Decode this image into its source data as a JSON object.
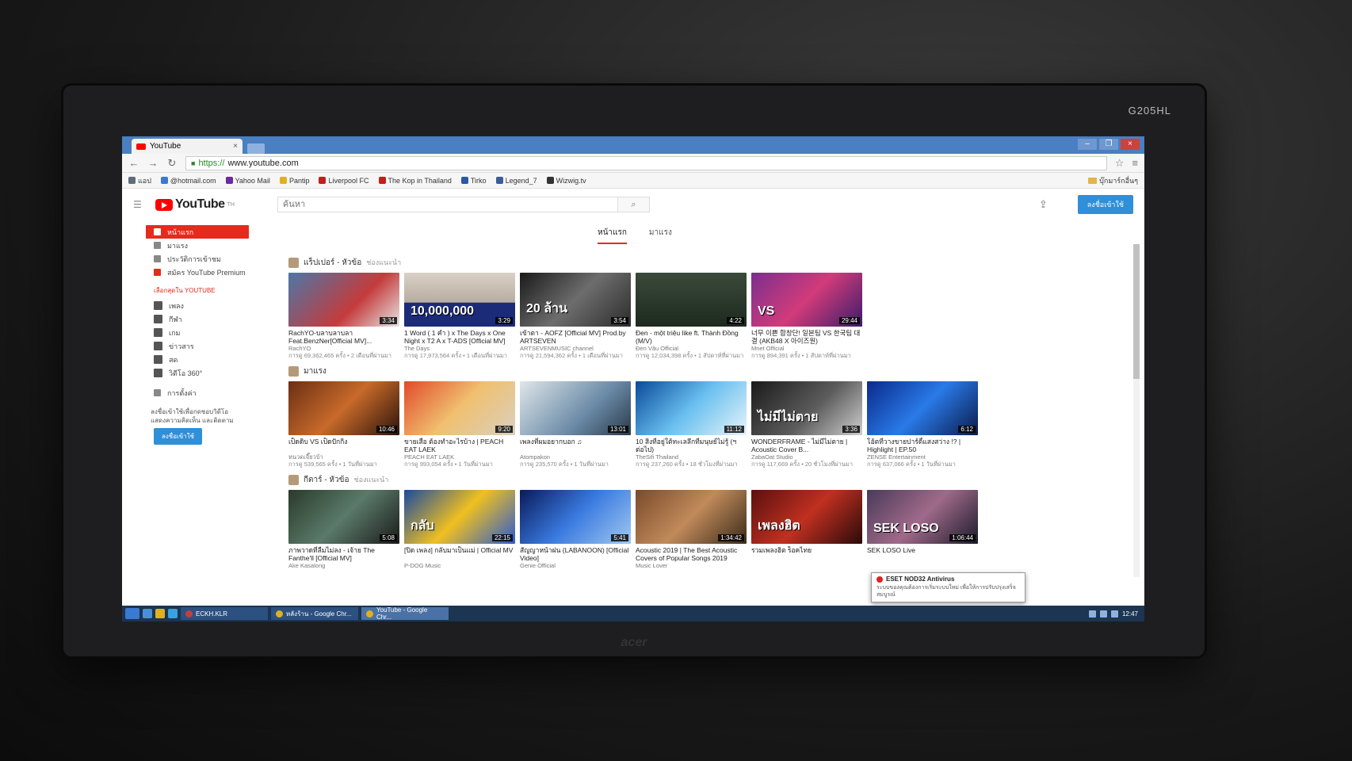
{
  "monitor": {
    "model": "G205HL",
    "brand": "acer"
  },
  "browser": {
    "tab_title": "YouTube",
    "tab_close": "×",
    "window_buttons": [
      "–",
      "❐",
      "×"
    ],
    "url_https": "https://",
    "url_rest": "www.youtube.com",
    "bookmarks": [
      {
        "label": "แอป",
        "color": "#5f6b7a"
      },
      {
        "label": "@hotmail.com",
        "color": "#3a7ad0"
      },
      {
        "label": "Yahoo Mail",
        "color": "#6a2aa0"
      },
      {
        "label": "Pantip",
        "color": "#e0b020"
      },
      {
        "label": "Liverpool FC",
        "color": "#c0201a"
      },
      {
        "label": "The Kop in Thailand",
        "color": "#c0201a"
      },
      {
        "label": "Tirko",
        "color": "#2a5aa0"
      },
      {
        "label": "Legend_7",
        "color": "#3a5a9a"
      },
      {
        "label": "Wizwig.tv",
        "color": "#333333"
      }
    ],
    "bookmarks_other": "บุ๊กมาร์กอื่นๆ"
  },
  "youtube": {
    "logo_text": "YouTube",
    "logo_sup": "TH",
    "search_placeholder": "ค้นหา",
    "signin_label": "ลงชื่อเข้าใช้",
    "tabs": [
      {
        "label": "หน้าแรก",
        "active": true
      },
      {
        "label": "มาแรง",
        "active": false
      }
    ],
    "sidebar": {
      "primary": [
        {
          "label": "หน้าแรก",
          "active": true
        },
        {
          "label": "มาแรง",
          "active": false
        },
        {
          "label": "ประวัติการเข้าชม",
          "active": false
        },
        {
          "label": "สมัคร YouTube Premium",
          "active": false
        }
      ],
      "section_title": "เลือกสุดใน YOUTUBE",
      "best": [
        "เพลง",
        "กีฬา",
        "เกม",
        "ข่าวสาร",
        "สด",
        "วิดีโอ 360°"
      ],
      "settings_label": "การตั้งค่า",
      "signin_note": "ลงชื่อเข้าใช้เพื่อกดชอบวิดีโอ แสดงความคิดเห็น และติดตาม",
      "signin_label": "ลงชื่อเข้าใช้"
    },
    "shelves": [
      {
        "title": "แร็ปเปอร์ - หัวข้อ",
        "subtitle": "ช่องแนะนำ",
        "videos": [
          {
            "title": "RachYO-บลาบลาบลา Feat.BenzNer[Official MV]...",
            "channel": "RachYO",
            "meta": "การดู 69,362,465 ครั้ง • 2 เดือนที่ผ่านมา",
            "duration": "3:34",
            "thumb_class": "t1",
            "thumb_text": ""
          },
          {
            "title": "1 Word ( 1 คำ ) x The Days x One Night x T2 A x T-ADS [Official MV]",
            "channel": "The Days",
            "meta": "การดู 17,973,564 ครั้ง • 1 เดือนที่ผ่านมา",
            "duration": "3:29",
            "thumb_class": "t2",
            "thumb_text": "10,000,000"
          },
          {
            "title": "เข้าตา - AOFZ [Official MV] Prod.by ARTSEVEN",
            "channel": "ARTSEVENMUSIC channel",
            "meta": "การดู 21,594,362 ครั้ง • 1 เดือนที่ผ่านมา",
            "duration": "3:54",
            "thumb_class": "t3",
            "thumb_text": "20 ล้าน"
          },
          {
            "title": "Đen - một triệu like ft. Thành Đồng (M/V)",
            "channel": "Đen Vâu Official",
            "meta": "การดู 12,034,398 ครั้ง • 1 สัปดาห์ที่ผ่านมา",
            "duration": "4:22",
            "thumb_class": "t4",
            "thumb_text": ""
          },
          {
            "title": "너무 이쁜 합창단! 일본팀 VS 한국팀 대결 (AKB48 X 아이즈원)",
            "channel": "Mnet Official",
            "meta": "การดู 894,391 ครั้ง • 1 สัปดาห์ที่ผ่านมา",
            "duration": "29:44",
            "thumb_class": "t5",
            "thumb_text": "VS"
          }
        ]
      },
      {
        "title": "มาแรง",
        "subtitle": "",
        "videos": [
          {
            "title": "เป็ดดิบ VS เป็ดปักกิ่ง",
            "channel": "หนวดเจี๊ยวบ้า",
            "meta": "การดู 539,565 ครั้ง • 1 วันที่ผ่านมา",
            "duration": "10:46",
            "thumb_class": "t6",
            "thumb_text": ""
          },
          {
            "title": "ขายเสื่อ ต้องทำอะไรบ้าง | PEACH EAT LAEK",
            "channel": "PEACH EAT LAEK",
            "meta": "การดู 993,054 ครั้ง • 1 วันที่ผ่านมา",
            "duration": "9:20",
            "thumb_class": "t7",
            "thumb_text": ""
          },
          {
            "title": "เพลงที่ผมอยากบอก ♫",
            "channel": "Atompakon",
            "meta": "การดู 235,570 ครั้ง • 1 วันที่ผ่านมา",
            "duration": "13:01",
            "thumb_class": "t8",
            "thumb_text": ""
          },
          {
            "title": "10 สิ่งที่อยู่ใต้ทะเลลึกที่มนุษย์ไม่รู้ (ฯ ต่อไป)",
            "channel": "TheSifi Thailand",
            "meta": "การดู 237,260 ครั้ง • 18 ชั่วโมงที่ผ่านมา",
            "duration": "11:12",
            "thumb_class": "t9",
            "thumb_text": ""
          },
          {
            "title": "WONDERFRAME - ไม่มีไม่ตาย | Acoustic Cover B...",
            "channel": "ZabaOat Studio",
            "meta": "การดู 117,669 ครั้ง • 20 ชั่วโมงที่ผ่านมา",
            "duration": "3:36",
            "thumb_class": "t10",
            "thumb_text": "ไม่มีไม่ตาย"
          },
          {
            "title": "โอ้ตที่วางขายปาร์ตี้แสงสว่าง !? | Highlight | EP.50",
            "channel": "ZENSE Entertainment",
            "meta": "การดู 637,066 ครั้ง • 1 วันที่ผ่านมา",
            "duration": "6:12",
            "thumb_class": "t11",
            "thumb_text": ""
          }
        ]
      },
      {
        "title": "กีตาร์ - หัวข้อ",
        "subtitle": "ช่องแนะนำ",
        "videos": [
          {
            "title": "ภาพวาดที่ลืมไม่ลง - เจ้าย The Fanthe'll [Official MV]",
            "channel": "Ake Kasalong",
            "meta": "",
            "duration": "5:08",
            "thumb_class": "t12",
            "thumb_text": ""
          },
          {
            "title": "[ปิด เพลง] กลับมาเป็นแม่ | Official MV",
            "channel": "P-DOG Music",
            "meta": "",
            "duration": "22:15",
            "thumb_class": "t13",
            "thumb_text": "กลับ"
          },
          {
            "title": "สัญญาหน้าฝน (LABANOON) [Official Video]",
            "channel": "Genie Official",
            "meta": "",
            "duration": "5:41",
            "thumb_class": "t14",
            "thumb_text": ""
          },
          {
            "title": "Acoustic 2019 | The Best Acoustic Covers of Popular Songs 2019",
            "channel": "Music Lover",
            "meta": "",
            "duration": "1:34:42",
            "thumb_class": "t15",
            "thumb_text": ""
          },
          {
            "title": "รวมเพลงฮิต ร็อคไทย",
            "channel": "",
            "meta": "",
            "duration": "",
            "thumb_class": "t16",
            "thumb_text": "เพลงฮิต"
          },
          {
            "title": "SEK LOSO Live",
            "channel": "",
            "meta": "",
            "duration": "1:06:44",
            "thumb_class": "t17",
            "thumb_text": "SEK LOSO"
          }
        ]
      }
    ]
  },
  "notification": {
    "title": "ESET NOD32 Antivirus",
    "body": "ระบบของคุณต้องการเริ่มระบบใหม่ เพื่อให้การปรับปรุงเสร็จสมบูรณ์"
  },
  "taskbar": {
    "tasks": [
      {
        "label": "ECKH.KLR",
        "color": "#c04040",
        "active": false
      },
      {
        "label": "หลังร้าน - Google Chr...",
        "color": "#e0b020",
        "active": false
      },
      {
        "label": "YouTube - Google Chr...",
        "color": "#e0b020",
        "active": true
      }
    ],
    "clock": "12:47"
  }
}
